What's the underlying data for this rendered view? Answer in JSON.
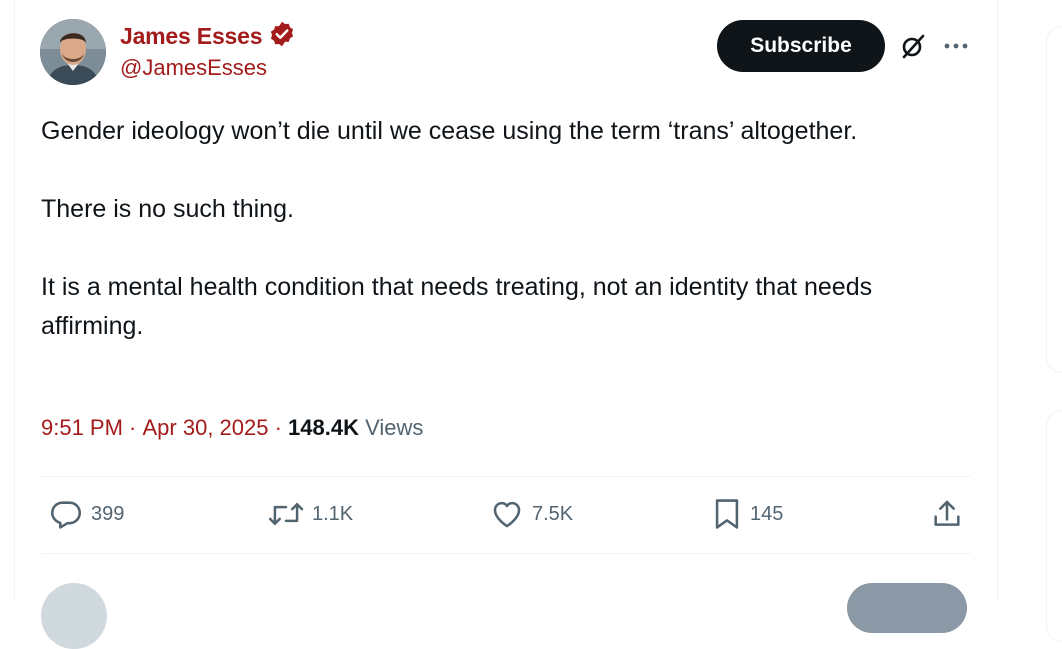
{
  "author": {
    "name": "James Esses",
    "handle": "@JamesEsses",
    "verified_color": "#a31b1b"
  },
  "header": {
    "subscribe_label": "Subscribe",
    "grok_icon": "slashed-circle-icon",
    "more_icon": "ellipsis-icon"
  },
  "tweet": {
    "paragraphs": [
      "Gender ideology won’t die until we cease using the term ‘trans’ altogether.",
      "There is no such thing.",
      "It is a mental health condition that needs treating, not an identity that needs affirming."
    ]
  },
  "meta": {
    "time": "9:51 PM",
    "separator": " · ",
    "date": "Apr 30, 2025",
    "views_count": "148.4K",
    "views_label": "Views"
  },
  "actions": {
    "replies": "399",
    "reposts": "1.1K",
    "likes": "7.5K",
    "bookmarks": "145"
  },
  "colors": {
    "accent": "#a31b1b",
    "text": "#0f1419",
    "muted": "#536471",
    "button": "#0f1419"
  }
}
